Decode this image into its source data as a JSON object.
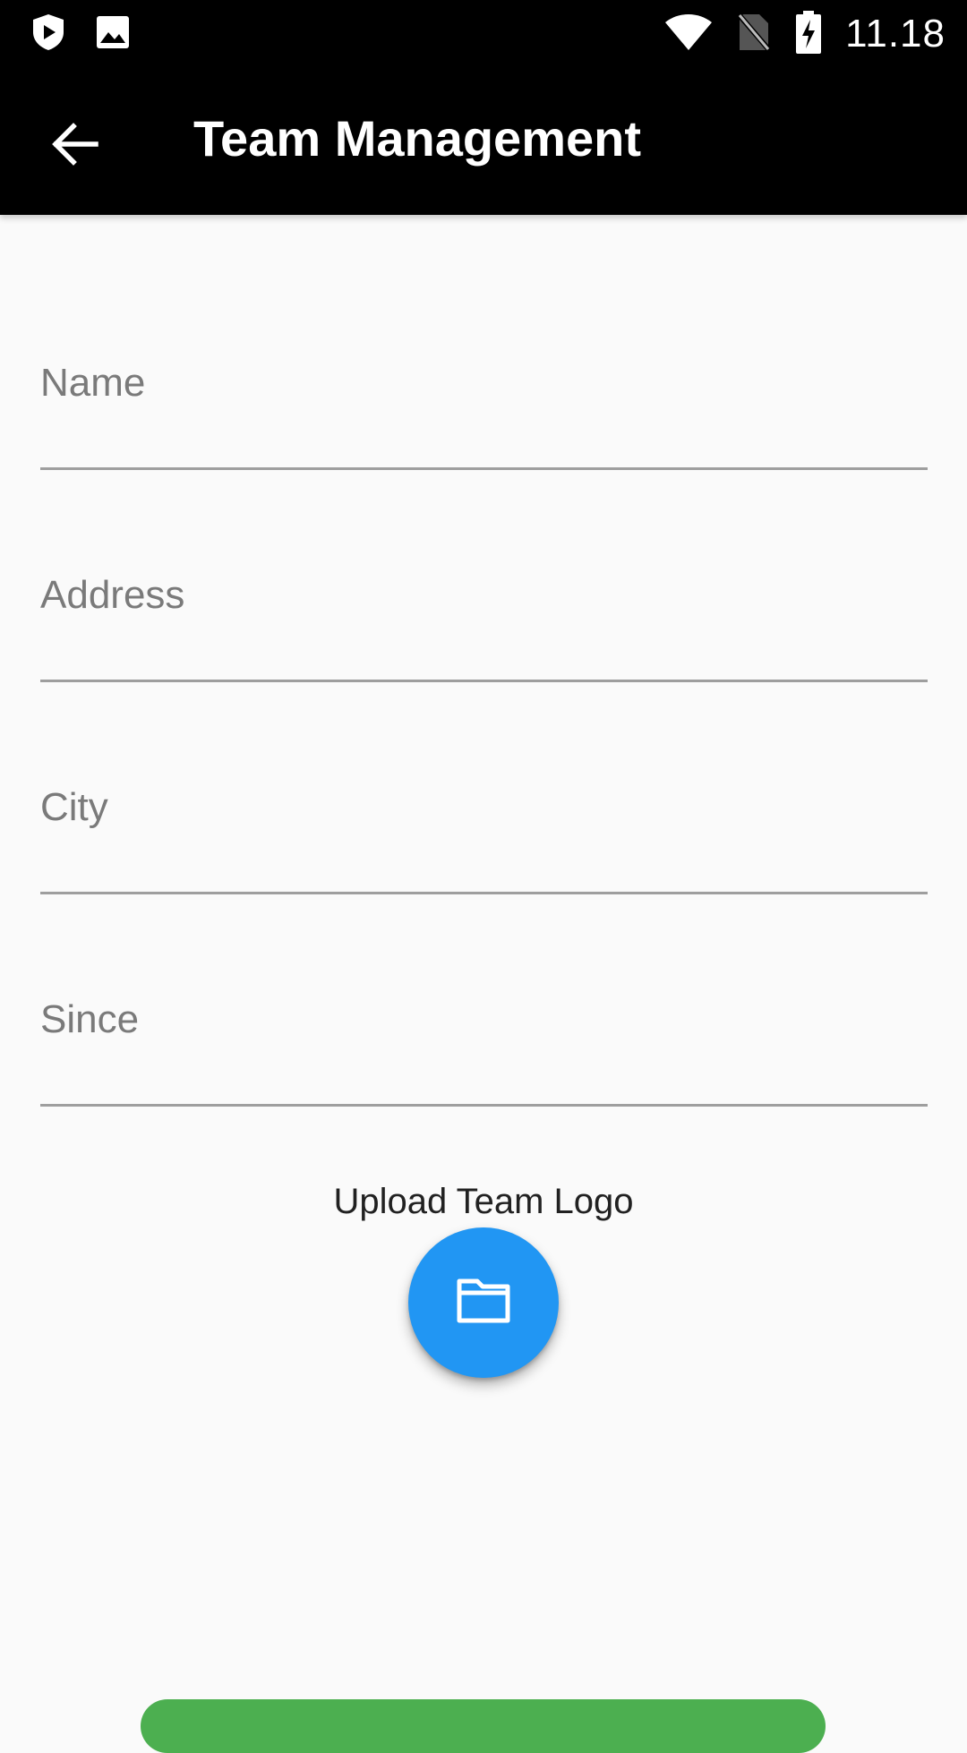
{
  "status_bar": {
    "time": "11.18",
    "icons": [
      "play-protect-icon",
      "gallery-icon",
      "wifi-icon",
      "no-sim-icon",
      "battery-charging-icon"
    ]
  },
  "app_bar": {
    "title": "Team Management",
    "back_icon": "arrow-back-icon"
  },
  "form": {
    "fields": [
      {
        "label": "Name",
        "value": ""
      },
      {
        "label": "Address",
        "value": ""
      },
      {
        "label": "City",
        "value": ""
      },
      {
        "label": "Since",
        "value": ""
      }
    ],
    "upload_label": "Upload Team Logo",
    "upload_icon": "folder-icon"
  },
  "colors": {
    "app_bar": "#000000",
    "background": "#fafafa",
    "fab": "#2196f3",
    "submit_button": "#4caf50",
    "field_underline": "#9e9e9e",
    "field_label": "#7a7a7a"
  }
}
